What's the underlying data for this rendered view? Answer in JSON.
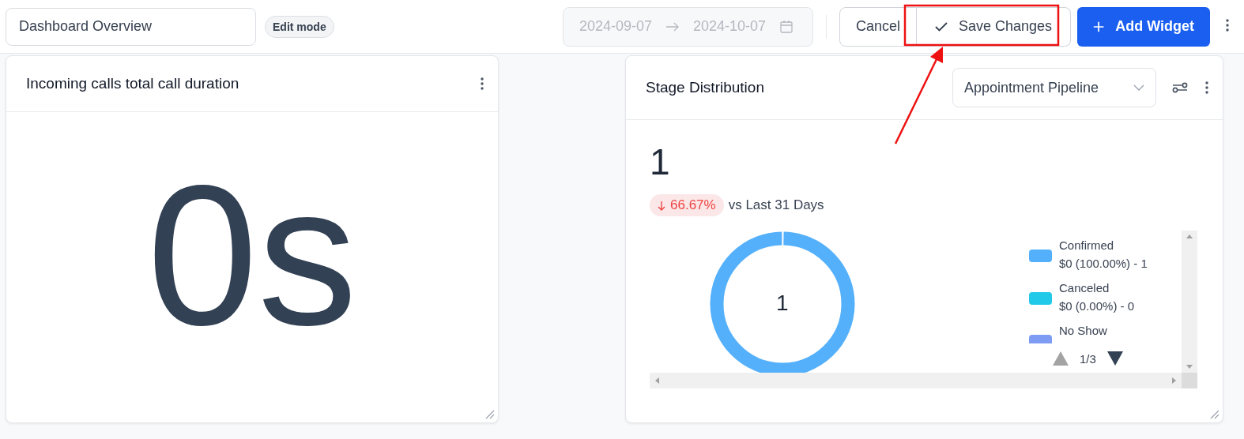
{
  "toolbar": {
    "dashboard_name": "Dashboard Overview",
    "mode_badge": "Edit mode",
    "date_range": {
      "start": "2024-09-07",
      "end": "2024-10-07"
    },
    "buttons": [
      {
        "label": "Cancel",
        "kind": "secondary"
      },
      {
        "label": "Save Changes",
        "kind": "save"
      },
      {
        "label": "Add Widget",
        "kind": "primary"
      }
    ]
  },
  "widgets": [
    {
      "kind": "metric",
      "title": "Incoming calls total call duration",
      "value": "0s"
    },
    {
      "kind": "distribution",
      "title": "Stage Distribution",
      "pipeline": "Appointment Pipeline",
      "total": "1",
      "change": {
        "value": "66.67%",
        "decreasing": true
      },
      "comparison": "vs Last 31 Days",
      "donut_label": "1",
      "legend": [
        {
          "name": "Confirmed",
          "detail": "$0 (100.00%) - 1",
          "color": "#55b0fb"
        },
        {
          "name": "Canceled",
          "detail": "$0 (0.00%) - 0",
          "color": "#22c9e8"
        },
        {
          "name": "No Show",
          "color": "#7f9cf5"
        }
      ],
      "page": "1/3"
    }
  ]
}
